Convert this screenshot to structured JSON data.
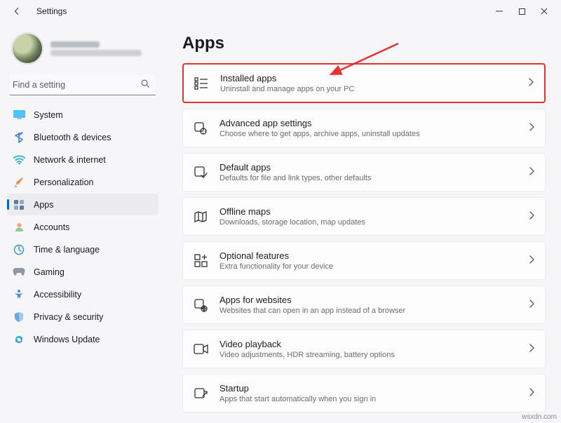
{
  "window": {
    "title": "Settings"
  },
  "search": {
    "placeholder": "Find a setting"
  },
  "sidebar": {
    "items": [
      {
        "label": "System"
      },
      {
        "label": "Bluetooth & devices"
      },
      {
        "label": "Network & internet"
      },
      {
        "label": "Personalization"
      },
      {
        "label": "Apps"
      },
      {
        "label": "Accounts"
      },
      {
        "label": "Time & language"
      },
      {
        "label": "Gaming"
      },
      {
        "label": "Accessibility"
      },
      {
        "label": "Privacy & security"
      },
      {
        "label": "Windows Update"
      }
    ]
  },
  "main": {
    "title": "Apps",
    "cards": [
      {
        "title": "Installed apps",
        "sub": "Uninstall and manage apps on your PC"
      },
      {
        "title": "Advanced app settings",
        "sub": "Choose where to get apps, archive apps, uninstall updates"
      },
      {
        "title": "Default apps",
        "sub": "Defaults for file and link types, other defaults"
      },
      {
        "title": "Offline maps",
        "sub": "Downloads, storage location, map updates"
      },
      {
        "title": "Optional features",
        "sub": "Extra functionality for your device"
      },
      {
        "title": "Apps for websites",
        "sub": "Websites that can open in an app instead of a browser"
      },
      {
        "title": "Video playback",
        "sub": "Video adjustments, HDR streaming, battery options"
      },
      {
        "title": "Startup",
        "sub": "Apps that start automatically when you sign in"
      }
    ]
  },
  "watermark": "wsxdn.com"
}
